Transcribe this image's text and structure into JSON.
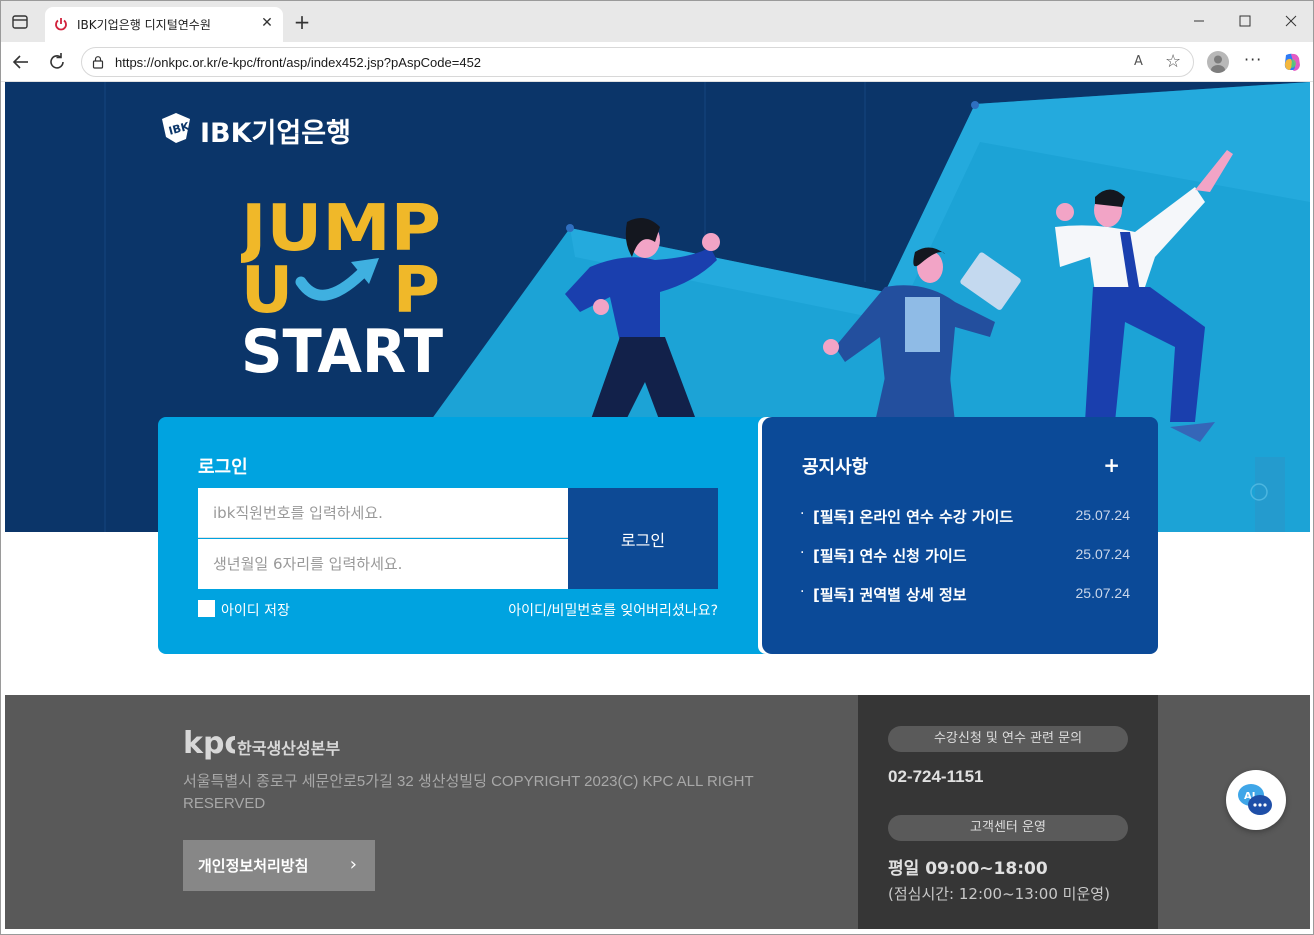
{
  "browser": {
    "tab_title": "IBK기업은행 디지털연수원",
    "tab_close": "✕",
    "new_tab": "+",
    "url": "https://onkpc.or.kr/e-kpc/front/asp/index452.jsp?pAspCode=452",
    "read_aloud": "A",
    "favorite": "☆",
    "more": "···"
  },
  "hero": {
    "brand": "IBK기업은행",
    "slogan_line1": "JUMP",
    "slogan_line2_u": "U",
    "slogan_line2_p": "P",
    "slogan_line3": "START",
    "colors": {
      "dark_navy": "#0b3569",
      "sky": "#1ca3d6",
      "slogan_yellow": "#f0b829"
    }
  },
  "login": {
    "title": "로그인",
    "id_placeholder": "ibk직원번호를 입력하세요.",
    "pw_placeholder": "생년월일 6자리를 입력하세요.",
    "button": "로그인",
    "save_id": "아이디 저장",
    "find": "아이디/비밀번호를 잊어버리셨나요?"
  },
  "notice": {
    "title": "공지사항",
    "more": "+",
    "bullet": "·",
    "items": [
      {
        "title": "[필독] 온라인 연수 수강 가이드",
        "date": "25.07.24"
      },
      {
        "title": "[필독] 연수 신청 가이드",
        "date": "25.07.24"
      },
      {
        "title": "[필독] 권역별 상세 정보",
        "date": "25.07.24"
      }
    ]
  },
  "footer": {
    "org_name": "한국생산성본부",
    "org_logo": "kpc",
    "address": "서울특별시 종로구 세문안로5가길 32 생산성빌딩 COPYRIGHT 2023(C) KPC ALL RIGHT RESERVED",
    "privacy": "개인정보처리방침",
    "privacy_chevron": "›",
    "inquiry_label": "수강신청 및 연수 관련 문의",
    "phone": "02-724-1151",
    "center_label": "고객센터 운영",
    "hours": "평일 09:00~18:00",
    "hours_note": "(점심시간: 12:00~13:00 미운영)"
  },
  "chat": {
    "label": "AI"
  }
}
